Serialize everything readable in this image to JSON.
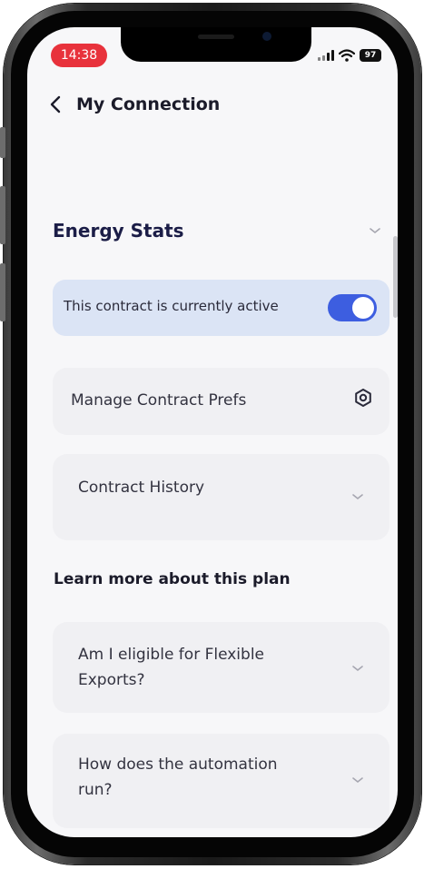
{
  "status_bar": {
    "time": "14:38",
    "battery": "97"
  },
  "nav": {
    "back_icon": "chevron-left-icon",
    "title": "My Connection"
  },
  "energy_section": {
    "title": "Energy Stats",
    "chevron_icon": "chevron-down-icon"
  },
  "active_card": {
    "label": "This contract is currently active",
    "toggle_on": true,
    "accent_color": "#3d5ee0"
  },
  "manage_prefs": {
    "label": "Manage Contract Prefs",
    "icon": "gear-icon"
  },
  "contract_history": {
    "label": "Contract History",
    "icon": "chevron-down-icon"
  },
  "learn_more": {
    "title": "Learn more about this plan",
    "faqs": [
      {
        "question": "Am I eligible for Flexible Exports?"
      },
      {
        "question": "How does the automation run?"
      }
    ]
  }
}
